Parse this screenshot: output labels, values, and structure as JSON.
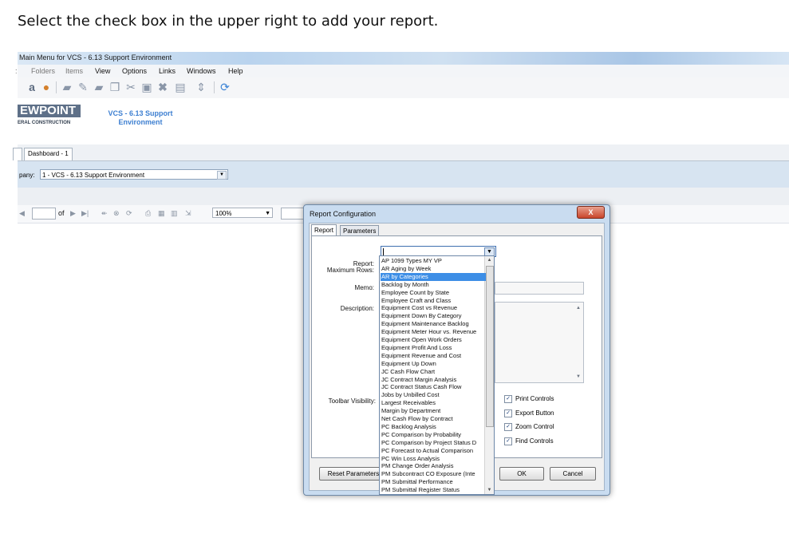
{
  "instruction": "Select the check box in the upper right to add your report.",
  "window": {
    "title": "Main Menu for VCS - 6.13 Support Environment"
  },
  "menu": [
    "Folders",
    "Items",
    "View",
    "Options",
    "Links",
    "Windows",
    "Help"
  ],
  "logo": {
    "text": "EWPOINT",
    "subtitle": "ERAL CONSTRUCTION"
  },
  "env_title": [
    "VCS - 6.13 Support",
    "Environment"
  ],
  "tab": "Dashboard - 1",
  "company": {
    "label": "pany:",
    "value": "1 - VCS - 6.13 Support Environment"
  },
  "viewer": {
    "of_label": "of",
    "zoom": "100%"
  },
  "dialog": {
    "title": "Report Configuration",
    "close": "X",
    "tabs": [
      "Report",
      "Parameters"
    ],
    "labels": {
      "report": "Report:",
      "max_rows": "Maximum Rows:",
      "memo": "Memo:",
      "description": "Description:",
      "toolbar_visibility": "Toolbar Visibility:"
    },
    "checkboxes": [
      "Print Controls",
      "Export Button",
      "Zoom Control",
      "Find Controls"
    ],
    "buttons": {
      "reset": "Reset Parameters",
      "ok": "OK",
      "cancel": "Cancel"
    }
  },
  "report_options": [
    "AP 1099 Types MY VP",
    "AR Aging by Week",
    "AR by Categories",
    "Backlog by Month",
    "Employee Count by State",
    "Employee Craft and Class",
    "Equipment Cost vs Revenue",
    "Equipment Down By Category",
    "Equipment Maintenance Backlog",
    "Equipment Meter Hour vs. Revenue",
    "Equipment Open Work Orders",
    "Equipment Profit And Loss",
    "Equipment Revenue and Cost",
    "Equipment Up Down",
    "JC Cash Flow Chart",
    "JC Contract Margin Analysis",
    "JC Contract Status Cash Flow",
    "Jobs by Unbilled Cost",
    "Largest Receivables",
    "Margin by Department",
    "Net Cash Flow by Contract",
    "PC Backlog Analysis",
    "PC Comparison by Probability",
    "PC Comparison by Project Status D",
    "PC Forecast to Actual Comparison",
    "PC Win Loss Analysis",
    "PM Change Order Analysis",
    "PM Subcontract CO Exposure (Inte",
    "PM Submittal Performance",
    "PM Submittal Register Status"
  ],
  "selected_option": "AR by Categories",
  "colors": {
    "selection": "#3d8ee6",
    "accent": "#3d7fd1",
    "close": "#c9452b"
  }
}
